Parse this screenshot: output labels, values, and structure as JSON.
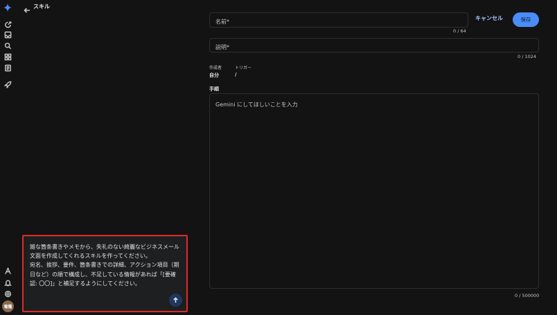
{
  "header": {
    "title": "スキル"
  },
  "sidebar": {
    "icons": [
      "gemini-sparkle-icon",
      "new-chat-icon",
      "inbox-icon",
      "search-icon",
      "apps-icon",
      "notes-icon",
      "rocket-icon"
    ],
    "bottom_icons": [
      "labs-icon",
      "bell-icon",
      "settings-icon"
    ],
    "avatar_text": "竜隆"
  },
  "form": {
    "name_placeholder": "名前*",
    "name_counter": "0 / 64",
    "cancel_label": "キャンセル",
    "save_label": "保存",
    "description_placeholder": "説明*",
    "description_counter": "0 / 1024",
    "creator_label": "作成者",
    "creator_value": "自分",
    "trigger_label": "トリガー",
    "trigger_value": "/",
    "steps_label": "手順",
    "steps_placeholder": "Gemini にしてほしいことを入力",
    "steps_counter": "0 / 500000"
  },
  "chat": {
    "message": "雑な箇条書きやメモから、失礼のない綺麗なビジネスメール文面を作成してくれるスキルを作ってください。\n宛名、挨拶、要件、箇条書きでの詳細、アクション項目（期日など）の順で構成し、不足している情報があれば「[要確認: 〇〇]」と補足するようにしてください。"
  },
  "colors": {
    "background": "#131314",
    "accent": "#4a8df8",
    "highlight_border": "#e02b2b"
  }
}
